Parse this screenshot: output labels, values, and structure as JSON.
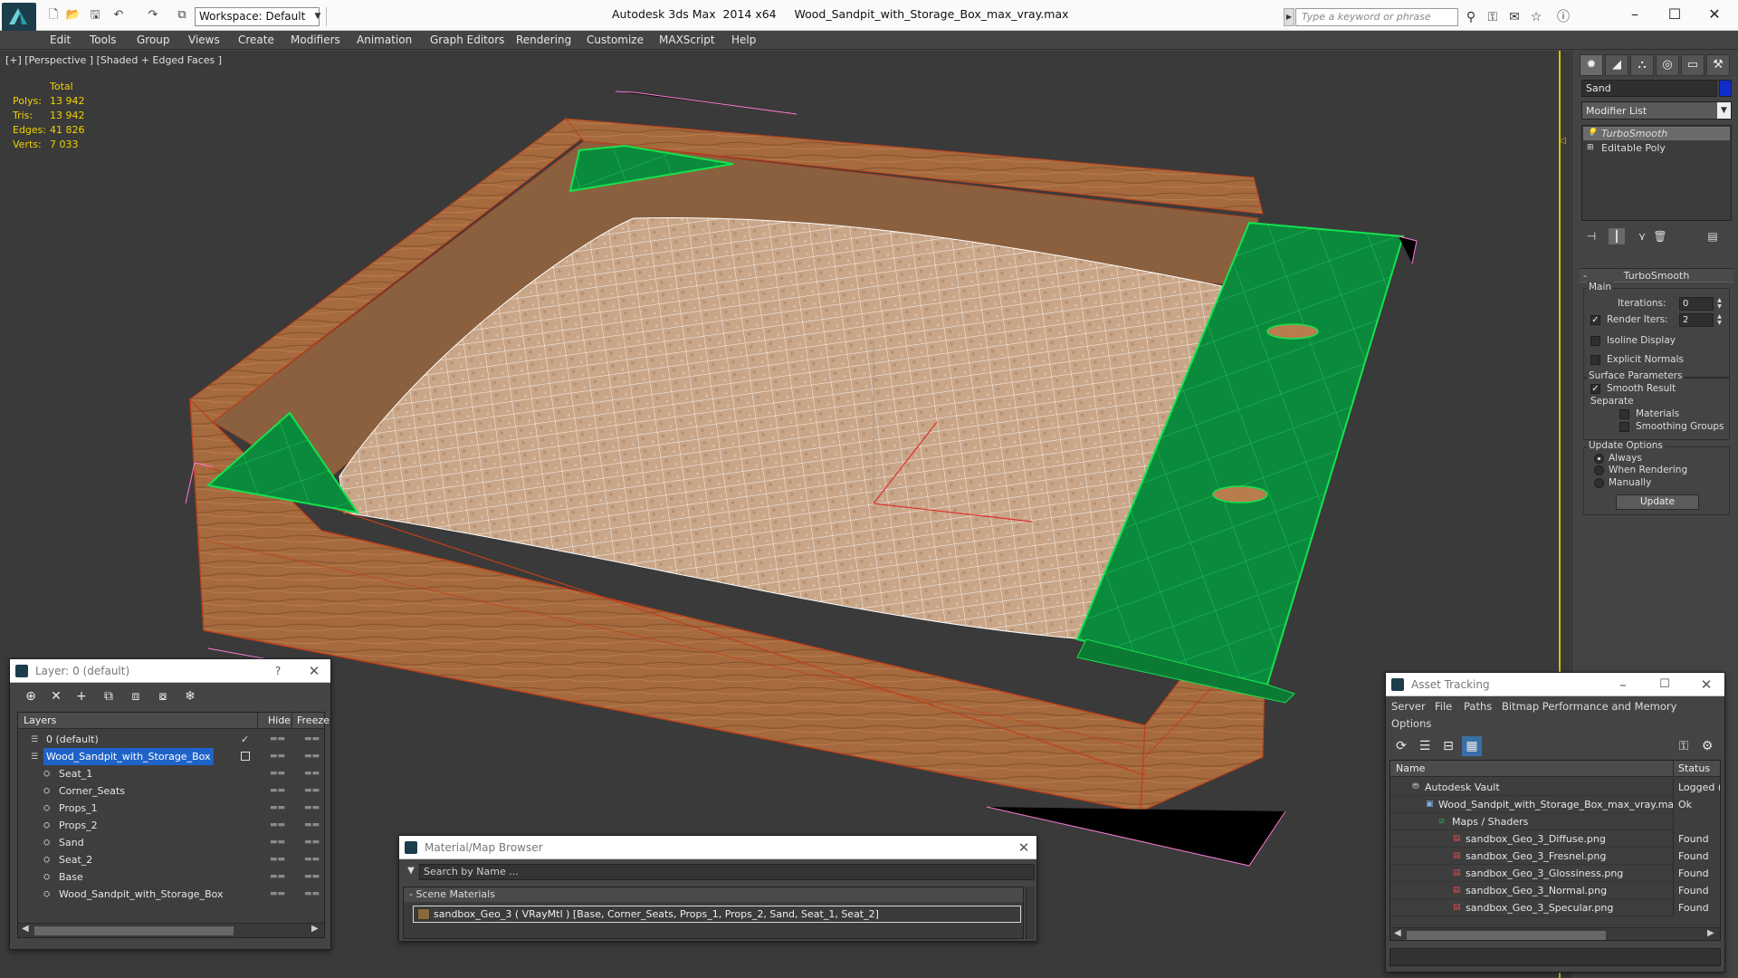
{
  "titlebar": {
    "workspace": "Workspace: Default",
    "app_name": "Autodesk 3ds Max  2014 x64",
    "file_name": "Wood_Sandpit_with_Storage_Box_max_vray.max",
    "search_placeholder": "Type a keyword or phrase"
  },
  "menu": [
    "Edit",
    "Tools",
    "Group",
    "Views",
    "Create",
    "Modifiers",
    "Animation",
    "Graph Editors",
    "Rendering",
    "Customize",
    "MAXScript",
    "Help"
  ],
  "viewport": {
    "label": "[+] [Perspective ] [Shaded + Edged Faces ]",
    "stats_header": "Total",
    "stats": [
      {
        "label": "Polys:",
        "value": "13 942"
      },
      {
        "label": "Tris:",
        "value": "13 942"
      },
      {
        "label": "Edges:",
        "value": "41 826"
      },
      {
        "label": "Verts:",
        "value": "7 033"
      }
    ]
  },
  "command_panel": {
    "object_name": "Sand",
    "object_color": "#0e2dc9",
    "modifier_list": "Modifier List",
    "stack": [
      "TurboSmooth",
      "Editable Poly"
    ],
    "rollout_title": "TurboSmooth",
    "main_group": "Main",
    "iterations_label": "Iterations:",
    "iterations_value": "0",
    "render_iters_label": "Render Iters:",
    "render_iters_value": "2",
    "isoline": "Isoline Display",
    "explicit_normals": "Explicit Normals",
    "surface_group": "Surface Parameters",
    "smooth_result": "Smooth Result",
    "separate": "Separate",
    "materials": "Materials",
    "smoothing_groups": "Smoothing Groups",
    "update_group": "Update Options",
    "always": "Always",
    "when_rendering": "When Rendering",
    "manually": "Manually",
    "update_button": "Update"
  },
  "layer_dialog": {
    "title": "Layer: 0 (default)",
    "help": "?",
    "col_layers": "Layers",
    "col_hide": "Hide",
    "col_freeze": "Freeze",
    "rows": [
      {
        "name": "0 (default)",
        "level": 0,
        "selected": false
      },
      {
        "name": "Wood_Sandpit_with_Storage_Box",
        "level": 0,
        "selected": true
      },
      {
        "name": "Seat_1",
        "level": 1,
        "selected": false
      },
      {
        "name": "Corner_Seats",
        "level": 1,
        "selected": false
      },
      {
        "name": "Props_1",
        "level": 1,
        "selected": false
      },
      {
        "name": "Props_2",
        "level": 1,
        "selected": false
      },
      {
        "name": "Sand",
        "level": 1,
        "selected": false
      },
      {
        "name": "Seat_2",
        "level": 1,
        "selected": false
      },
      {
        "name": "Base",
        "level": 1,
        "selected": false
      },
      {
        "name": "Wood_Sandpit_with_Storage_Box",
        "level": 1,
        "selected": false
      }
    ]
  },
  "material_browser": {
    "title": "Material/Map Browser",
    "search_placeholder": "Search by Name ...",
    "section": "Scene Materials",
    "item": "sandbox_Geo_3  ( VRayMtl ) [Base, Corner_Seats, Props_1, Props_2, Sand, Seat_1, Seat_2]"
  },
  "asset_tracking": {
    "title": "Asset Tracking",
    "menu": [
      "Server",
      "File",
      "Paths",
      "Bitmap Performance and Memory",
      "Options"
    ],
    "col_name": "Name",
    "col_status": "Status",
    "rows": [
      {
        "name": "Autodesk Vault",
        "status": "Logged (",
        "level": 0
      },
      {
        "name": "Wood_Sandpit_with_Storage_Box_max_vray.max",
        "status": "Ok",
        "level": 1
      },
      {
        "name": "Maps / Shaders",
        "status": "",
        "level": 2
      },
      {
        "name": "sandbox_Geo_3_Diffuse.png",
        "status": "Found",
        "level": 3
      },
      {
        "name": "sandbox_Geo_3_Fresnel.png",
        "status": "Found",
        "level": 3
      },
      {
        "name": "sandbox_Geo_3_Glossiness.png",
        "status": "Found",
        "level": 3
      },
      {
        "name": "sandbox_Geo_3_Normal.png",
        "status": "Found",
        "level": 3
      },
      {
        "name": "sandbox_Geo_3_Specular.png",
        "status": "Found",
        "level": 3
      }
    ]
  }
}
